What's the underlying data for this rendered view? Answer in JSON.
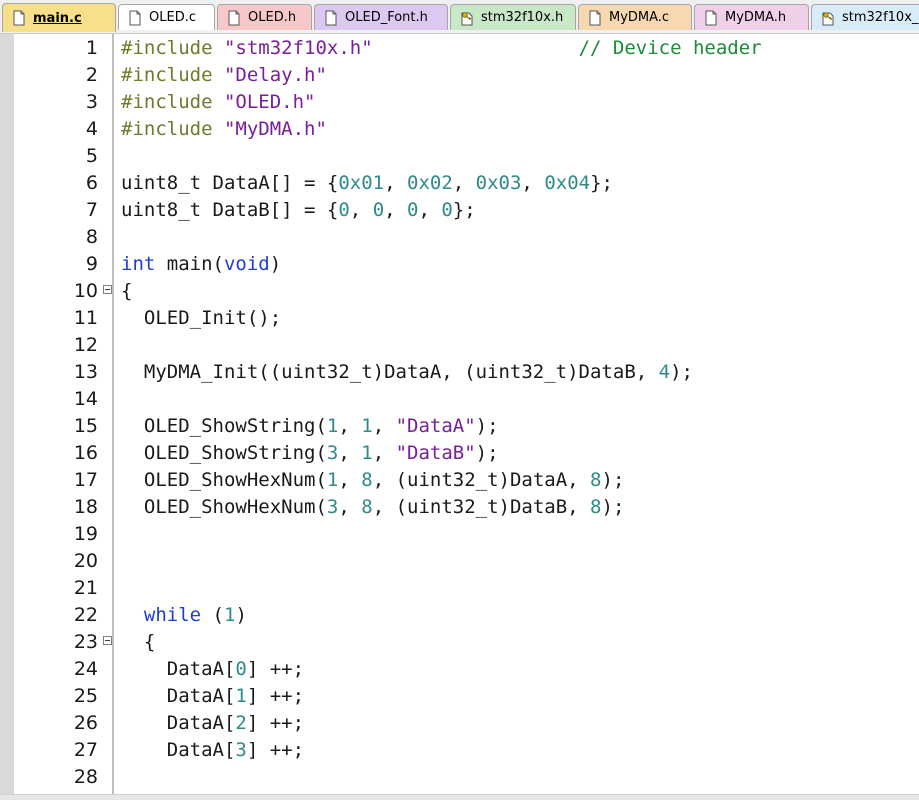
{
  "tabs": [
    {
      "label": "main.c",
      "color": "#f8e08a",
      "active": true,
      "icon": "file-icon"
    },
    {
      "label": "OLED.c",
      "color": "#ffffff",
      "active": false,
      "icon": "file-icon"
    },
    {
      "label": "OLED.h",
      "color": "#f8c8c8",
      "active": false,
      "icon": "file-icon"
    },
    {
      "label": "OLED_Font.h",
      "color": "#dcc8f0",
      "active": false,
      "icon": "file-icon"
    },
    {
      "label": "stm32f10x.h",
      "color": "#c8e8c8",
      "active": false,
      "icon": "key-file-icon"
    },
    {
      "label": "MyDMA.c",
      "color": "#f8d8b0",
      "active": false,
      "icon": "file-icon"
    },
    {
      "label": "MyDMA.h",
      "color": "#f0d0e8",
      "active": false,
      "icon": "file-icon"
    },
    {
      "label": "stm32f10x_",
      "color": "#d8ecf8",
      "active": false,
      "icon": "key-file-icon"
    }
  ],
  "colors": {
    "preprocessor": "#6e7b2b",
    "string": "#7a1f9c",
    "number": "#2e8b8b",
    "keyword": "#1f3fcf",
    "comment": "#1e8a3a",
    "text": "#1a1a1a"
  },
  "lines": [
    {
      "n": "1",
      "tokens": [
        [
          "pre",
          "#include "
        ],
        [
          "str",
          "\"stm32f10x.h\""
        ],
        [
          "plain",
          "                  "
        ],
        [
          "cmt",
          "// Device header"
        ]
      ]
    },
    {
      "n": "2",
      "tokens": [
        [
          "pre",
          "#include "
        ],
        [
          "str",
          "\"Delay.h\""
        ]
      ]
    },
    {
      "n": "3",
      "tokens": [
        [
          "pre",
          "#include "
        ],
        [
          "str",
          "\"OLED.h\""
        ]
      ]
    },
    {
      "n": "4",
      "tokens": [
        [
          "pre",
          "#include "
        ],
        [
          "str",
          "\"MyDMA.h\""
        ]
      ]
    },
    {
      "n": "5",
      "tokens": []
    },
    {
      "n": "6",
      "tokens": [
        [
          "plain",
          "uint8_t DataA[] = {"
        ],
        [
          "num",
          "0x01"
        ],
        [
          "plain",
          ", "
        ],
        [
          "num",
          "0x02"
        ],
        [
          "plain",
          ", "
        ],
        [
          "num",
          "0x03"
        ],
        [
          "plain",
          ", "
        ],
        [
          "num",
          "0x04"
        ],
        [
          "plain",
          "};"
        ]
      ]
    },
    {
      "n": "7",
      "tokens": [
        [
          "plain",
          "uint8_t DataB[] = {"
        ],
        [
          "num",
          "0"
        ],
        [
          "plain",
          ", "
        ],
        [
          "num",
          "0"
        ],
        [
          "plain",
          ", "
        ],
        [
          "num",
          "0"
        ],
        [
          "plain",
          ", "
        ],
        [
          "num",
          "0"
        ],
        [
          "plain",
          "};"
        ]
      ]
    },
    {
      "n": "8",
      "tokens": []
    },
    {
      "n": "9",
      "tokens": [
        [
          "kw",
          "int"
        ],
        [
          "plain",
          " main("
        ],
        [
          "kw",
          "void"
        ],
        [
          "plain",
          ")"
        ]
      ]
    },
    {
      "n": "10",
      "fold": true,
      "tokens": [
        [
          "plain",
          "{"
        ]
      ]
    },
    {
      "n": "11",
      "tokens": [
        [
          "plain",
          "  OLED_Init();"
        ]
      ]
    },
    {
      "n": "12",
      "tokens": []
    },
    {
      "n": "13",
      "tokens": [
        [
          "plain",
          "  MyDMA_Init((uint32_t)DataA, (uint32_t)DataB, "
        ],
        [
          "num",
          "4"
        ],
        [
          "plain",
          ");"
        ]
      ]
    },
    {
      "n": "14",
      "tokens": []
    },
    {
      "n": "15",
      "tokens": [
        [
          "plain",
          "  OLED_ShowString("
        ],
        [
          "num",
          "1"
        ],
        [
          "plain",
          ", "
        ],
        [
          "num",
          "1"
        ],
        [
          "plain",
          ", "
        ],
        [
          "str",
          "\"DataA\""
        ],
        [
          "plain",
          ");"
        ]
      ]
    },
    {
      "n": "16",
      "tokens": [
        [
          "plain",
          "  OLED_ShowString("
        ],
        [
          "num",
          "3"
        ],
        [
          "plain",
          ", "
        ],
        [
          "num",
          "1"
        ],
        [
          "plain",
          ", "
        ],
        [
          "str",
          "\"DataB\""
        ],
        [
          "plain",
          ");"
        ]
      ]
    },
    {
      "n": "17",
      "tokens": [
        [
          "plain",
          "  OLED_ShowHexNum("
        ],
        [
          "num",
          "1"
        ],
        [
          "plain",
          ", "
        ],
        [
          "num",
          "8"
        ],
        [
          "plain",
          ", (uint32_t)DataA, "
        ],
        [
          "num",
          "8"
        ],
        [
          "plain",
          ");"
        ]
      ]
    },
    {
      "n": "18",
      "tokens": [
        [
          "plain",
          "  OLED_ShowHexNum("
        ],
        [
          "num",
          "3"
        ],
        [
          "plain",
          ", "
        ],
        [
          "num",
          "8"
        ],
        [
          "plain",
          ", (uint32_t)DataB, "
        ],
        [
          "num",
          "8"
        ],
        [
          "plain",
          ");"
        ]
      ]
    },
    {
      "n": "19",
      "tokens": []
    },
    {
      "n": "20",
      "tokens": []
    },
    {
      "n": "21",
      "tokens": []
    },
    {
      "n": "22",
      "tokens": [
        [
          "plain",
          "  "
        ],
        [
          "kw",
          "while"
        ],
        [
          "plain",
          " ("
        ],
        [
          "num",
          "1"
        ],
        [
          "plain",
          ")"
        ]
      ]
    },
    {
      "n": "23",
      "fold": true,
      "tokens": [
        [
          "plain",
          "  {"
        ]
      ]
    },
    {
      "n": "24",
      "tokens": [
        [
          "plain",
          "    DataA["
        ],
        [
          "num",
          "0"
        ],
        [
          "plain",
          "] ++;"
        ]
      ]
    },
    {
      "n": "25",
      "tokens": [
        [
          "plain",
          "    DataA["
        ],
        [
          "num",
          "1"
        ],
        [
          "plain",
          "] ++;"
        ]
      ]
    },
    {
      "n": "26",
      "tokens": [
        [
          "plain",
          "    DataA["
        ],
        [
          "num",
          "2"
        ],
        [
          "plain",
          "] ++;"
        ]
      ]
    },
    {
      "n": "27",
      "tokens": [
        [
          "plain",
          "    DataA["
        ],
        [
          "num",
          "3"
        ],
        [
          "plain",
          "] ++;"
        ]
      ]
    },
    {
      "n": "28",
      "tokens": []
    }
  ]
}
